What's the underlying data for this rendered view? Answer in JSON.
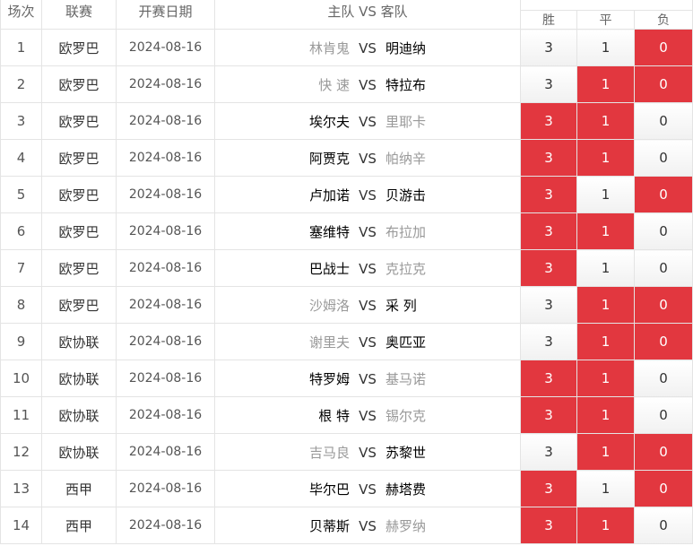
{
  "header": {
    "col_no": "场次",
    "col_league": "联赛",
    "col_date": "开赛日期",
    "col_match": "主队 VS 客队",
    "col_win": "胜",
    "col_draw": "平",
    "col_lose": "负"
  },
  "colors": {
    "selected": "#e2373f",
    "border": "#e4e4e4"
  },
  "rows": [
    {
      "no": "1",
      "league": "欧罗巴",
      "date": "2024-08-16",
      "home": "林肯鬼",
      "vs": "VS",
      "away": "明迪纳",
      "win": "3",
      "draw": "1",
      "lose": "0",
      "sel": [
        false,
        false,
        true
      ]
    },
    {
      "no": "2",
      "league": "欧罗巴",
      "date": "2024-08-16",
      "home": "快 速",
      "vs": "VS",
      "away": "特拉布",
      "win": "3",
      "draw": "1",
      "lose": "0",
      "sel": [
        false,
        true,
        true
      ]
    },
    {
      "no": "3",
      "league": "欧罗巴",
      "date": "2024-08-16",
      "home": "埃尔夫",
      "vs": "VS",
      "away": "里耶卡",
      "win": "3",
      "draw": "1",
      "lose": "0",
      "sel": [
        true,
        true,
        false
      ]
    },
    {
      "no": "4",
      "league": "欧罗巴",
      "date": "2024-08-16",
      "home": "阿贾克",
      "vs": "VS",
      "away": "帕纳辛",
      "win": "3",
      "draw": "1",
      "lose": "0",
      "sel": [
        true,
        true,
        false
      ]
    },
    {
      "no": "5",
      "league": "欧罗巴",
      "date": "2024-08-16",
      "home": "卢加诺",
      "vs": "VS",
      "away": "贝游击",
      "win": "3",
      "draw": "1",
      "lose": "0",
      "sel": [
        true,
        false,
        true
      ]
    },
    {
      "no": "6",
      "league": "欧罗巴",
      "date": "2024-08-16",
      "home": "塞维特",
      "vs": "VS",
      "away": "布拉加",
      "win": "3",
      "draw": "1",
      "lose": "0",
      "sel": [
        true,
        true,
        false
      ]
    },
    {
      "no": "7",
      "league": "欧罗巴",
      "date": "2024-08-16",
      "home": "巴战士",
      "vs": "VS",
      "away": "克拉克",
      "win": "3",
      "draw": "1",
      "lose": "0",
      "sel": [
        true,
        false,
        false
      ]
    },
    {
      "no": "8",
      "league": "欧罗巴",
      "date": "2024-08-16",
      "home": "沙姆洛",
      "vs": "VS",
      "away": "采 列",
      "win": "3",
      "draw": "1",
      "lose": "0",
      "sel": [
        false,
        true,
        true
      ]
    },
    {
      "no": "9",
      "league": "欧协联",
      "date": "2024-08-16",
      "home": "谢里夫",
      "vs": "VS",
      "away": "奥匹亚",
      "win": "3",
      "draw": "1",
      "lose": "0",
      "sel": [
        false,
        true,
        true
      ]
    },
    {
      "no": "10",
      "league": "欧协联",
      "date": "2024-08-16",
      "home": "特罗姆",
      "vs": "VS",
      "away": "基马诺",
      "win": "3",
      "draw": "1",
      "lose": "0",
      "sel": [
        true,
        true,
        false
      ]
    },
    {
      "no": "11",
      "league": "欧协联",
      "date": "2024-08-16",
      "home": "根 特",
      "vs": "VS",
      "away": "锡尔克",
      "win": "3",
      "draw": "1",
      "lose": "0",
      "sel": [
        true,
        true,
        false
      ]
    },
    {
      "no": "12",
      "league": "欧协联",
      "date": "2024-08-16",
      "home": "吉马良",
      "vs": "VS",
      "away": "苏黎世",
      "win": "3",
      "draw": "1",
      "lose": "0",
      "sel": [
        false,
        true,
        true
      ]
    },
    {
      "no": "13",
      "league": "西甲",
      "date": "2024-08-16",
      "home": "毕尔巴",
      "vs": "VS",
      "away": "赫塔费",
      "win": "3",
      "draw": "1",
      "lose": "0",
      "sel": [
        true,
        false,
        true
      ]
    },
    {
      "no": "14",
      "league": "西甲",
      "date": "2024-08-16",
      "home": "贝蒂斯",
      "vs": "VS",
      "away": "赫罗纳",
      "win": "3",
      "draw": "1",
      "lose": "0",
      "sel": [
        true,
        true,
        false
      ]
    }
  ]
}
